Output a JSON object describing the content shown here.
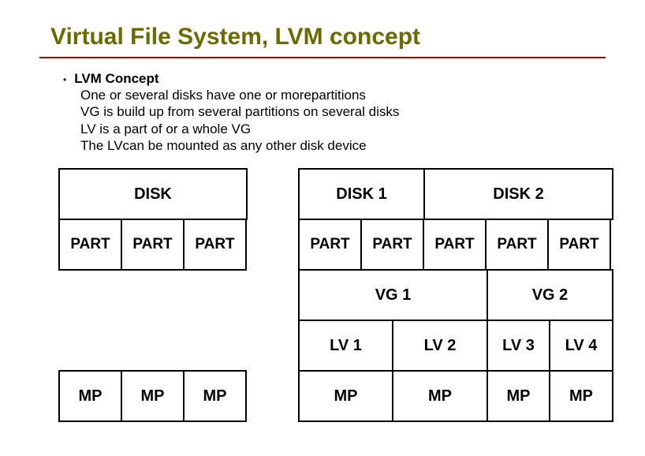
{
  "title": "Virtual File System, LVM concept",
  "bullet": {
    "heading": "LVM Concept",
    "lines": [
      "One or several disks have one or morepartitions",
      "VG is build up from several partitions on several disks",
      "LV is a part of or a whole VG",
      "The LVcan be mounted as any other disk device"
    ]
  },
  "left": {
    "disk": "DISK",
    "parts": [
      "PART",
      "PART",
      "PART"
    ],
    "mps": [
      "MP",
      "MP",
      "MP"
    ]
  },
  "right": {
    "disks": [
      "DISK 1",
      "DISK 2"
    ],
    "parts": [
      "PART",
      "PART",
      "PART",
      "PART",
      "PART"
    ],
    "vgs": [
      "VG 1",
      "VG 2"
    ],
    "lvs": [
      "LV 1",
      "LV 2",
      "LV 3",
      "LV 4"
    ],
    "mps": [
      "MP",
      "MP",
      "MP",
      "MP"
    ]
  }
}
